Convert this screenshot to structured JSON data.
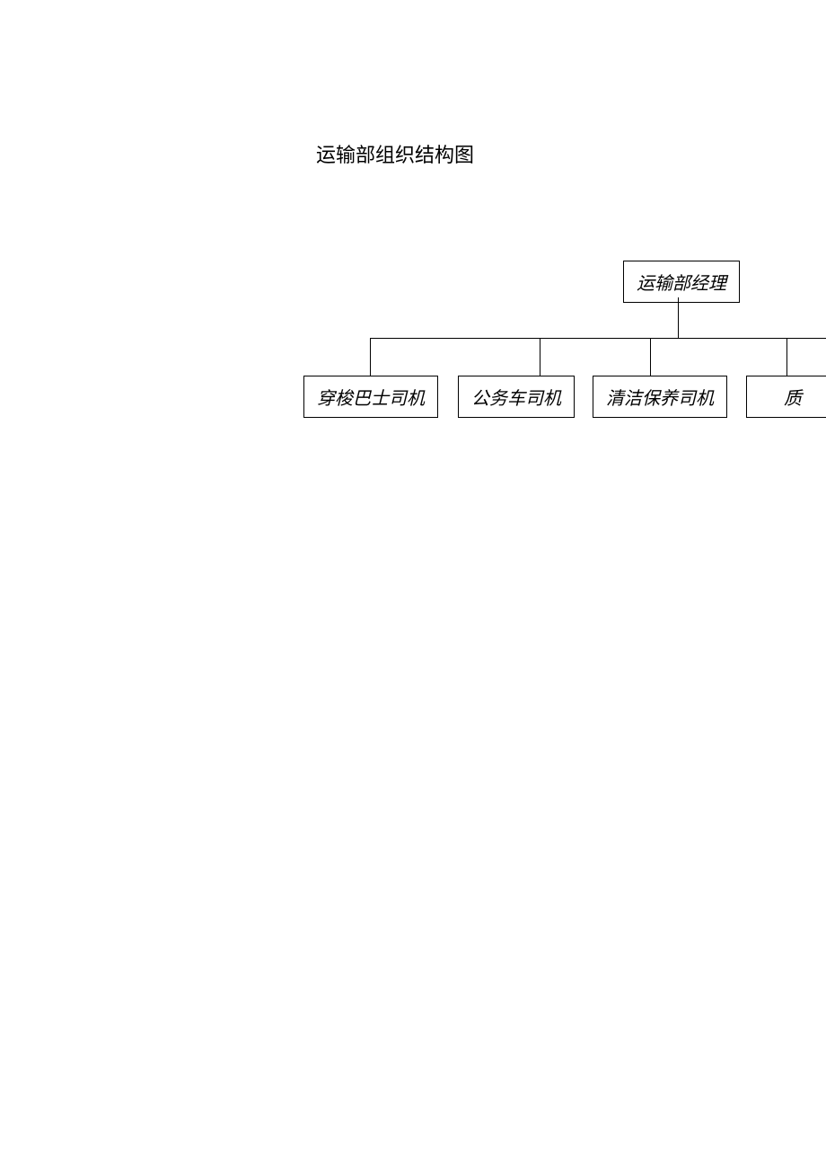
{
  "title": "运输部组织结构图",
  "org": {
    "manager": "运输部经理",
    "children": [
      "穿梭巴士司机",
      "公务车司机",
      "清洁保养司机",
      "质"
    ]
  }
}
